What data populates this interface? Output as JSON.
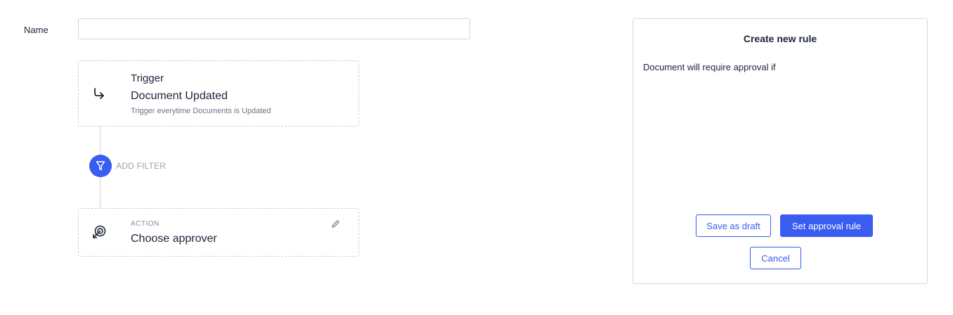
{
  "form": {
    "name_label": "Name",
    "name_value": "",
    "name_placeholder": ""
  },
  "trigger": {
    "title": "Trigger",
    "event": "Document Updated",
    "description": "Trigger everytime Documents is Updated",
    "icon": "arrow-return-icon"
  },
  "filter": {
    "label": "ADD FILTER",
    "icon": "filter-funnel-icon"
  },
  "action": {
    "label": "ACTION",
    "value": "Choose approver",
    "icon": "approver-target-icon",
    "edit_icon": "pencil-icon"
  },
  "panel": {
    "title": "Create new rule",
    "text": "Document will require approval if",
    "save_draft_label": "Save as draft",
    "set_rule_label": "Set approval rule",
    "cancel_label": "Cancel"
  },
  "colors": {
    "accent": "#3a5cf0",
    "border": "#cdd1d8",
    "text": "#1c2437",
    "muted": "#9aa0a8"
  }
}
